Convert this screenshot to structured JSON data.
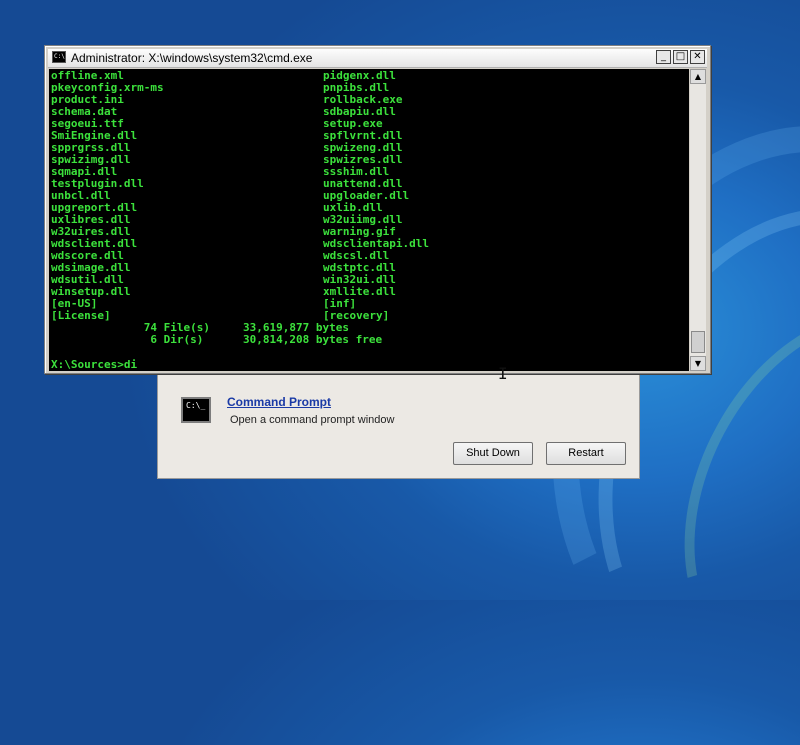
{
  "window": {
    "title": "Administrator: X:\\windows\\system32\\cmd.exe",
    "icon": "cmd-icon",
    "minimize": "_",
    "maximize": "□",
    "close": "✕"
  },
  "console": {
    "file_rows": [
      {
        "left": "offline.xml",
        "right": "pidgenx.dll"
      },
      {
        "left": "pkeyconfig.xrm-ms",
        "right": "pnpibs.dll"
      },
      {
        "left": "product.ini",
        "right": "rollback.exe"
      },
      {
        "left": "schema.dat",
        "right": "sdbapiu.dll"
      },
      {
        "left": "segoeui.ttf",
        "right": "setup.exe"
      },
      {
        "left": "SmiEngine.dll",
        "right": "spflvrnt.dll"
      },
      {
        "left": "spprgrss.dll",
        "right": "spwizeng.dll"
      },
      {
        "left": "spwizimg.dll",
        "right": "spwizres.dll"
      },
      {
        "left": "sqmapi.dll",
        "right": "ssshim.dll"
      },
      {
        "left": "testplugin.dll",
        "right": "unattend.dll"
      },
      {
        "left": "unbcl.dll",
        "right": "upgloader.dll"
      },
      {
        "left": "upgreport.dll",
        "right": "uxlib.dll"
      },
      {
        "left": "uxlibres.dll",
        "right": "w32uiimg.dll"
      },
      {
        "left": "w32uires.dll",
        "right": "warning.gif"
      },
      {
        "left": "wdsclient.dll",
        "right": "wdsclientapi.dll"
      },
      {
        "left": "wdscore.dll",
        "right": "wdscsl.dll"
      },
      {
        "left": "wdsimage.dll",
        "right": "wdstptc.dll"
      },
      {
        "left": "wdsutil.dll",
        "right": "win32ui.dll"
      },
      {
        "left": "winsetup.dll",
        "right": "xmllite.dll"
      },
      {
        "left": "[en-US]",
        "right": "[inf]"
      },
      {
        "left": "[License]",
        "right": "[recovery]"
      }
    ],
    "summary_files": "              74 File(s)     33,619,877 bytes",
    "summary_dirs": "               6 Dir(s)      30,814,208 bytes free",
    "prompt": "X:\\Sources>di"
  },
  "scrollbar": {
    "up": "▲",
    "down": "▼"
  },
  "recovery": {
    "icon_text": "C:\\_",
    "link": "Command Prompt",
    "description": "Open a command prompt window",
    "shutdown_label": "Shut Down",
    "restart_label": "Restart"
  }
}
